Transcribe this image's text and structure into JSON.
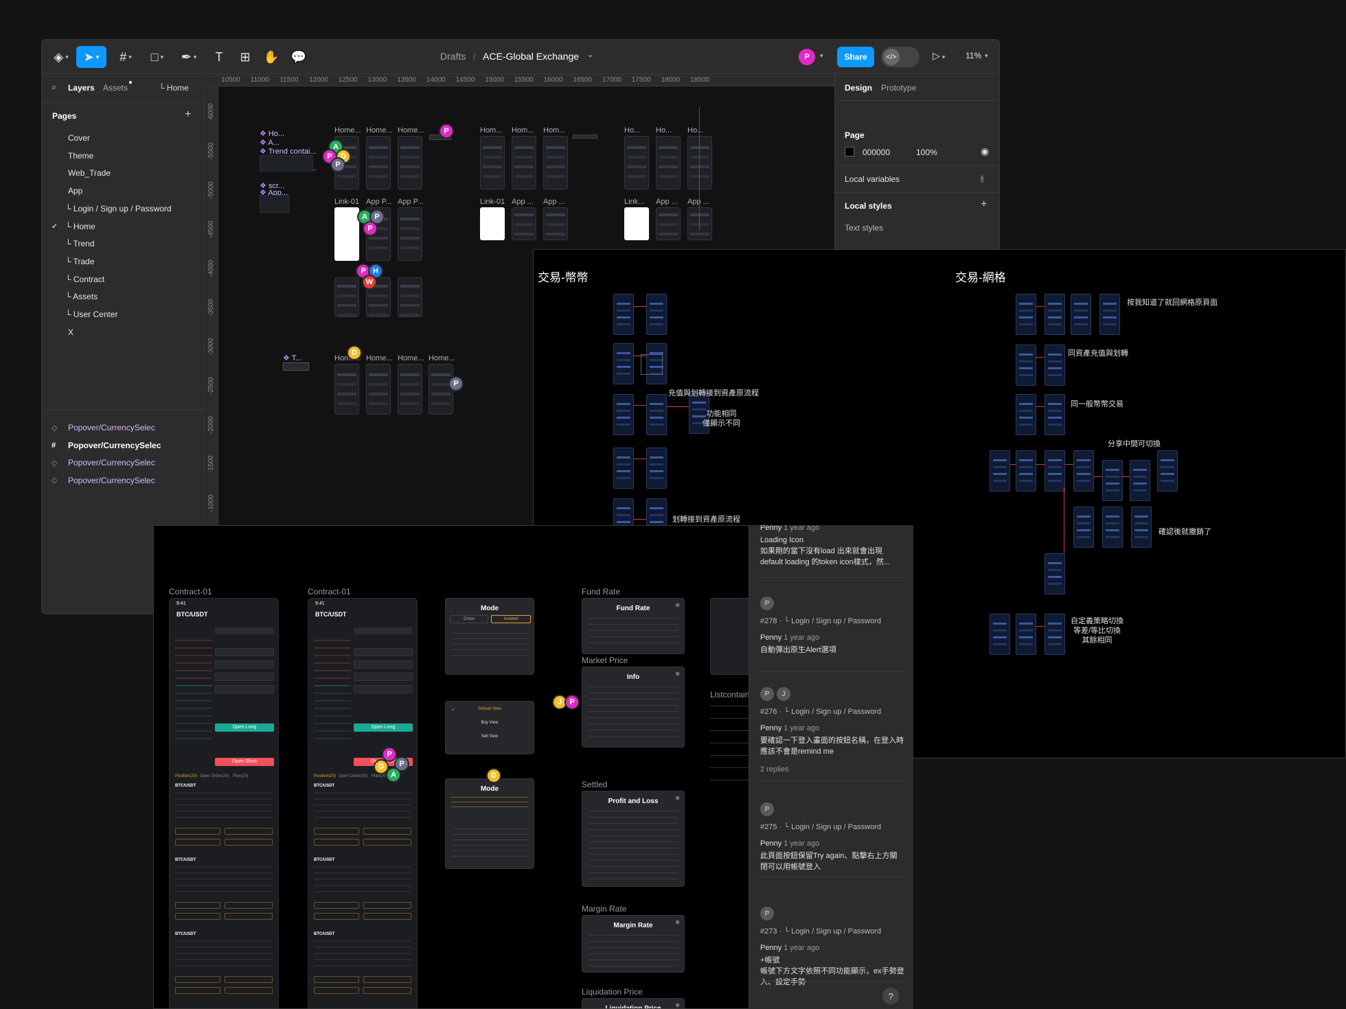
{
  "toolbar": {
    "breadcrumb_root": "Drafts",
    "separator": "/",
    "file_name": "ACE-Global Exchange",
    "avatar_letter": "P",
    "share_label": "Share",
    "zoom": "11%"
  },
  "left_panel": {
    "tab_layers": "Layers",
    "tab_assets": "Assets",
    "current_page_short": "└ Home",
    "pages_heading": "Pages",
    "pages": [
      {
        "label": "Cover"
      },
      {
        "label": "Theme"
      },
      {
        "label": "Web_Trade"
      },
      {
        "label": "App"
      },
      {
        "label": "└ Login / Sign up / Password"
      },
      {
        "label": "└ Home",
        "selected": true
      },
      {
        "label": "└ Trend"
      },
      {
        "label": "└ Trade"
      },
      {
        "label": "└ Contract"
      },
      {
        "label": "└ Assets"
      },
      {
        "label": "└ User Center"
      },
      {
        "label": "X"
      }
    ],
    "components": [
      {
        "label": "Popover/CurrencySelec"
      },
      {
        "label": "Popover/CurrencySelec"
      },
      {
        "label": "Popover/CurrencySelec"
      },
      {
        "label": "Popover/CurrencySelec"
      }
    ]
  },
  "canvas": {
    "ruler_x": [
      "10500",
      "11000",
      "11500",
      "12000",
      "12500",
      "13000",
      "13500",
      "14000",
      "14500",
      "15000",
      "15500",
      "16000",
      "16500",
      "17000",
      "17500",
      "18000",
      "18500"
    ],
    "ruler_y": [
      "-6000",
      "-5500",
      "-5000",
      "-4500",
      "-4000",
      "-3500",
      "-3000",
      "-2500",
      "-2000",
      "-1500",
      "-1000",
      "-500"
    ],
    "layer_items": [
      "Ho...",
      "A...",
      "Trend contai...",
      "Trend contai...",
      "scr...",
      "App...",
      "T..."
    ],
    "frame_labels_row1": [
      "Home...",
      "Home...",
      "Home...",
      "Hom...",
      "Hom...",
      "Hom...",
      "Ho...",
      "Ho...",
      "Ho..."
    ],
    "frame_labels_row2": [
      "Link-01",
      "App P...",
      "App P...",
      "Link-01",
      "App ...",
      "App ...",
      "Link...",
      "App ...",
      "App ..."
    ],
    "frame_labels_row4": [
      "Home...",
      "Home...",
      "Home...",
      "Home..."
    ]
  },
  "right_panel": {
    "tab_design": "Design",
    "tab_prototype": "Prototype",
    "page_heading": "Page",
    "page_color": "000000",
    "page_opacity": "100%",
    "local_variables": "Local variables",
    "local_styles": "Local styles",
    "text_styles": "Text styles"
  },
  "flow": {
    "title_left": "交易-幣幣",
    "title_right": "交易-網格",
    "notes_left": [
      "充值與划轉接到資產原流程",
      "功能相同\n僅顯示不同",
      "划轉接到資產原流程"
    ],
    "notes_right": [
      "按我知道了就回網格原頁面",
      "同資產充值與划轉",
      "同一般幣幣交易",
      "分享中間可切換",
      "確認後就撤銷了",
      "自定義策略切換\n等差/等比切換\n其餘相同"
    ]
  },
  "contract": {
    "labels": [
      "Contract-01",
      "Contract-01",
      "Fund Rate",
      "Market Price",
      "Settled",
      "Margin Rate",
      "Liquidation Price",
      "Listcontain"
    ],
    "pair": "BTC/USDT",
    "time": "9:41",
    "mode_title": "Mode",
    "mode_options": [
      "Cross",
      "Isolated"
    ],
    "view_options": [
      "Default View",
      "Buy View",
      "Sell View"
    ],
    "card_titles": [
      "Fund Rate",
      "Info",
      "Profit and Loss",
      "Margin Rate",
      "Liquidation Price"
    ],
    "open_long": "Open Long",
    "open_short": "Open Short",
    "positions_tab": "Position(20)",
    "orders_tab": "Open Order(20)",
    "plan_tab": "Plan(20)"
  },
  "comments": [
    {
      "author": "Penny",
      "time": "1 year ago",
      "body": "Loading Icon\n如果剛的當下沒有load 出來就會出現default loading 的token icon樣式，然..."
    },
    {
      "id": "#278",
      "page": "└ Login / Sign up / Password",
      "author": "Penny",
      "time": "1 year ago",
      "body": "自動彈出原生Alert選項"
    },
    {
      "id": "#276",
      "page": "└ Login / Sign up / Password",
      "author": "Penny",
      "time": "1 year ago",
      "body": "要確認一下登入畫面的按鈕名稱，在登入時應該不會是remind me",
      "replies": "2 replies"
    },
    {
      "id": "#275",
      "page": "└ Login / Sign up / Password",
      "author": "Penny",
      "time": "1 year ago",
      "body": "此頁面按鈕保留Try again、點擊右上方關閉可以用帳號登入"
    },
    {
      "id": "#273",
      "page": "└ Login / Sign up / Password",
      "author": "Penny",
      "time": "1 year ago",
      "body": "+帳號\n帳號下方文字依照不同功能顯示，ex手勢登入、設定手勢"
    }
  ],
  "colors": {
    "accent": "#0d99ff",
    "canvas": "#121212",
    "panel": "#2c2c2c",
    "long": "#1aa996",
    "short": "#f0505a"
  }
}
